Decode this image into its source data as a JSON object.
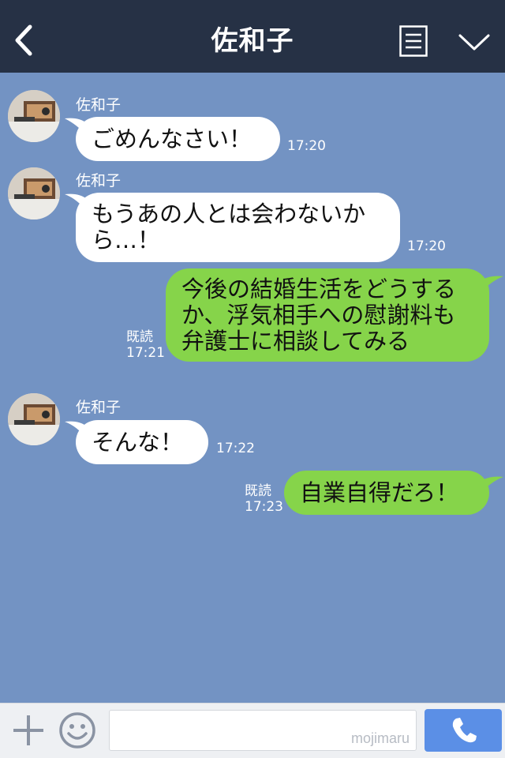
{
  "header": {
    "title": "佐和子",
    "back_icon": "chevron-left-icon",
    "menu_icon": "menu-list-icon",
    "dropdown_icon": "chevron-down-icon",
    "background": "#263145"
  },
  "chat": {
    "background": "#7393c3",
    "messages": [
      {
        "side": "in",
        "sender": "佐和子",
        "text": "ごめんなさい！",
        "time": "17:20"
      },
      {
        "side": "in",
        "sender": "佐和子",
        "text": "もうあの人とは会わないか\nら…！",
        "time": "17:20"
      },
      {
        "side": "out",
        "text": "今後の結婚生活をどうする\nか、浮気相手への慰謝料も\n弁護士に相談してみる",
        "read": "既読",
        "time": "17:21"
      },
      {
        "side": "in",
        "sender": "佐和子",
        "text": "そんな！",
        "time": "17:22"
      },
      {
        "side": "out",
        "text": "自業自得だろ！",
        "read": "既読",
        "time": "17:23"
      }
    ],
    "incoming_color": "#ffffff",
    "outgoing_color": "#86d44a"
  },
  "footer": {
    "plus_icon": "plus-icon",
    "emoji_icon": "smiley-icon",
    "input_watermark": "mojimaru",
    "call_icon": "phone-icon",
    "call_button_color": "#5b8fe6"
  }
}
